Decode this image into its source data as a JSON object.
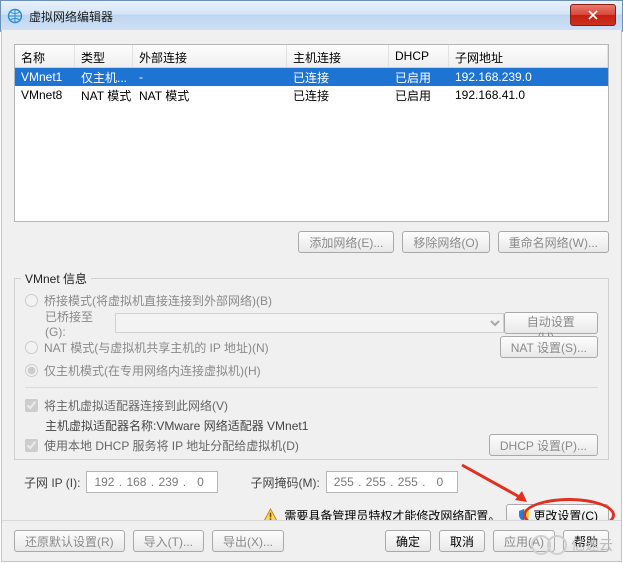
{
  "window": {
    "title": "虚拟网络编辑器"
  },
  "table": {
    "headers": [
      "名称",
      "类型",
      "外部连接",
      "主机连接",
      "DHCP",
      "子网地址"
    ],
    "rows": [
      {
        "name": "VMnet1",
        "type": "仅主机...",
        "ext": "-",
        "host": "已连接",
        "dhcp": "已启用",
        "subnet": "192.168.239.0",
        "selected": true
      },
      {
        "name": "VMnet8",
        "type": "NAT 模式",
        "ext": "NAT 模式",
        "host": "已连接",
        "dhcp": "已启用",
        "subnet": "192.168.41.0",
        "selected": false
      }
    ]
  },
  "table_buttons": {
    "add": "添加网络(E)...",
    "remove": "移除网络(O)",
    "rename": "重命名网络(W)..."
  },
  "group": {
    "legend": "VMnet 信息",
    "bridged_label": "桥接模式(将虚拟机直接连接到外部网络)(B)",
    "bridged_to_label": "已桥接至(G):",
    "auto_btn": "自动设置(U)...",
    "nat_label": "NAT 模式(与虚拟机共享主机的 IP 地址)(N)",
    "nat_btn": "NAT 设置(S)...",
    "hostonly_label": "仅主机模式(在专用网络内连接虚拟机)(H)",
    "connect_host_label": "将主机虚拟适配器连接到此网络(V)",
    "adapter_label_prefix": "主机虚拟适配器名称: ",
    "adapter_name": "VMware 网络适配器 VMnet1",
    "dhcp_check_label": "使用本地 DHCP 服务将 IP 地址分配给虚拟机(D)",
    "dhcp_btn": "DHCP 设置(P)..."
  },
  "subnet": {
    "ip_label": "子网 IP (I):",
    "ip": [
      "192",
      "168",
      "239",
      "0"
    ],
    "mask_label": "子网掩码(M):",
    "mask": [
      "255",
      "255",
      "255",
      "0"
    ]
  },
  "admin": {
    "notice": "需要具备管理员特权才能修改网络配置。",
    "change_btn": "更改设置(C)"
  },
  "bottom": {
    "restore": "还原默认设置(R)",
    "import": "导入(T)...",
    "export": "导出(X)...",
    "ok": "确定",
    "cancel": "取消",
    "apply": "应用(A)",
    "help": "帮助"
  },
  "watermark": "亿速云"
}
